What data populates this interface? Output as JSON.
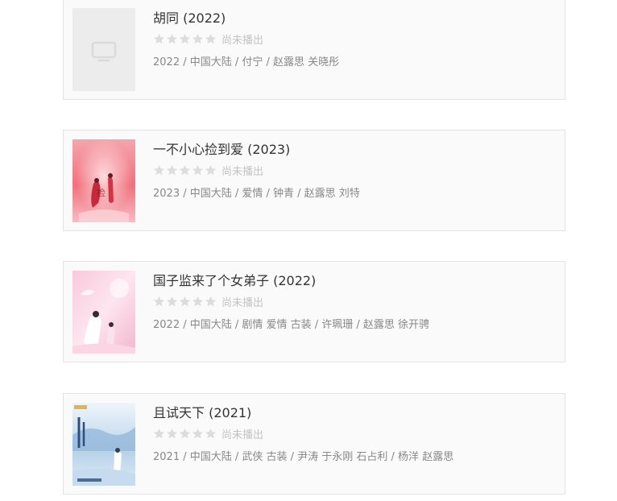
{
  "items": [
    {
      "title": "胡同 (2022)",
      "rating_text": "尚未播出",
      "meta": "2022 / 中国大陆 / 付宁 / 赵露思 关晓彤",
      "poster": "placeholder-tv-icon"
    },
    {
      "title": "一不小心捡到爱 (2023)",
      "rating_text": "尚未播出",
      "meta": "2023 / 中国大陆 / 爱情 / 钟青 / 赵露思 刘特",
      "poster": "poster-pink-red"
    },
    {
      "title": "国子监来了个女弟子 (2022)",
      "rating_text": "尚未播出",
      "meta": "2022 / 中国大陆 / 剧情 爱情 古装 / 许珮珊 / 赵露思 徐开骋",
      "poster": "poster-pink-white"
    },
    {
      "title": "且试天下 (2021)",
      "rating_text": "尚未播出",
      "meta": "2021 / 中国大陆 / 武侠 古装 / 尹涛 于永刚 石占利 / 杨洋 赵露思",
      "poster": "poster-blue-white"
    }
  ]
}
